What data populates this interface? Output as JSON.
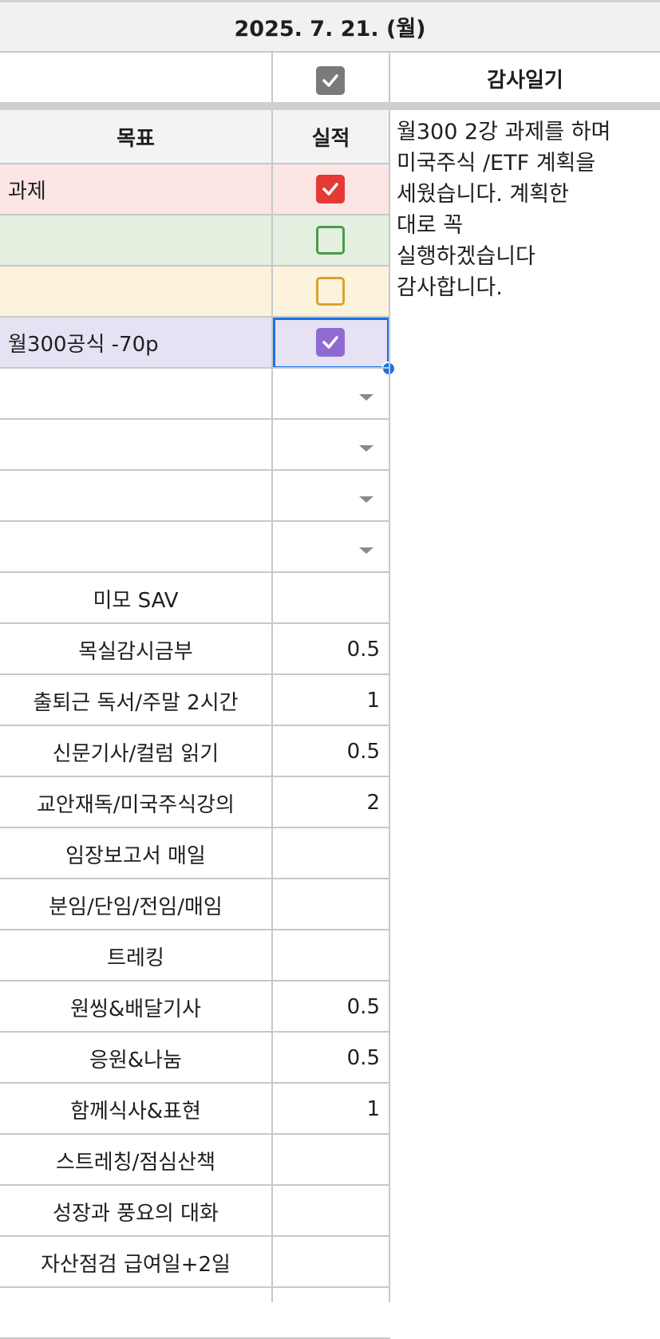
{
  "header": {
    "date": "2025. 7. 21. (월)"
  },
  "diary": {
    "title": "감사일기",
    "lines": [
      "월300 2강 과제를 하며",
      "미국주식 /ETF 계획을",
      "세웠습니다. 계획한",
      "대로 꼭",
      "실행하겠습니다",
      "감사합니다."
    ]
  },
  "goals": {
    "col_goal": "목표",
    "col_result": "실적",
    "rows": [
      {
        "text": "과제",
        "checked": true,
        "color": "#e53935",
        "bg": "#fbe5e5"
      },
      {
        "text": "",
        "checked": false,
        "color": "#4a9a4d",
        "bg": "#e3efdf"
      },
      {
        "text": "",
        "checked": false,
        "color": "#d7a32c",
        "bg": "#fdf2dc"
      },
      {
        "text": "월300공식 -70p",
        "checked": true,
        "color": "#8f6bd1",
        "bg": "#e6e2f3"
      }
    ]
  },
  "habits": [
    {
      "label": "미모 SAV",
      "value": ""
    },
    {
      "label": "목실감시금부",
      "value": "0.5"
    },
    {
      "label": "출퇴근 독서/주말 2시간",
      "value": "1"
    },
    {
      "label": "신문기사/컬럼 읽기",
      "value": "0.5"
    },
    {
      "label": "교안재독/미국주식강의",
      "value": "2"
    },
    {
      "label": "임장보고서  매일",
      "value": ""
    },
    {
      "label": "분임/단임/전임/매임",
      "value": ""
    },
    {
      "label": "트레킹",
      "value": ""
    },
    {
      "label": "원씽&배달기사",
      "value": "0.5"
    },
    {
      "label": "응원&나눔",
      "value": "0.5"
    },
    {
      "label": "함께식사&표현",
      "value": "1"
    },
    {
      "label": "스트레칭/점심산책",
      "value": ""
    },
    {
      "label": "성장과 풍요의 대화",
      "value": ""
    },
    {
      "label": "자산점검 급여일+2일",
      "value": ""
    }
  ]
}
